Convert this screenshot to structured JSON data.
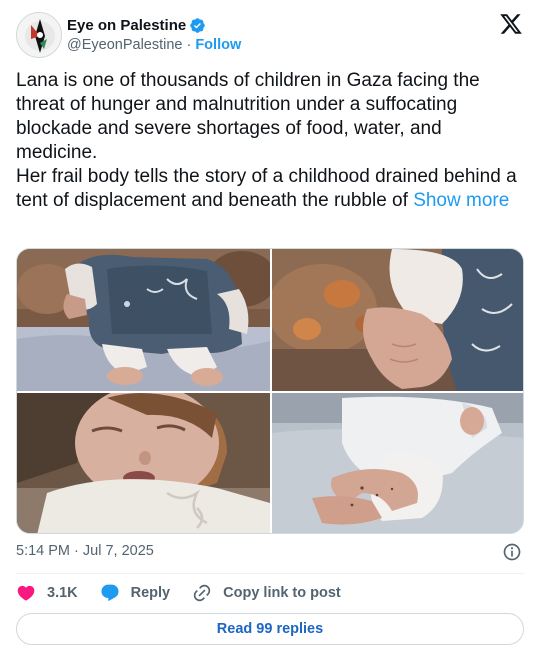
{
  "author": {
    "name": "Eye on Palestine",
    "handle": "@EyeonPalestine",
    "separator": "·",
    "follow_label": "Follow"
  },
  "tweet": {
    "text": "Lana is one of thousands of children in Gaza facing the threat of hunger and malnutrition under a suffocating blockade and severe shortages of food, water, and medicine.\nHer frail body tells the story of a childhood drained behind a tent of displacement and beneath the rubble of ",
    "show_more_label": "Show more"
  },
  "media": [
    {
      "name": "photo-child-body-on-blanket"
    },
    {
      "name": "photo-child-hand-closeup"
    },
    {
      "name": "photo-child-face"
    },
    {
      "name": "photo-child-legs"
    }
  ],
  "meta": {
    "timestamp": "5:14 PM · Jul 7, 2025"
  },
  "actions": {
    "like_count": "3.1K",
    "reply_label": "Reply",
    "copy_label": "Copy link to post"
  },
  "footer": {
    "read_replies_label": "Read 99 replies"
  },
  "colors": {
    "accent": "#1d9bf0",
    "like": "#f91880",
    "text": "#0f1419",
    "muted": "#536471"
  },
  "icons": [
    "verified-badge-icon",
    "x-logo-icon",
    "info-icon",
    "heart-icon",
    "reply-bubble-icon",
    "link-icon"
  ]
}
